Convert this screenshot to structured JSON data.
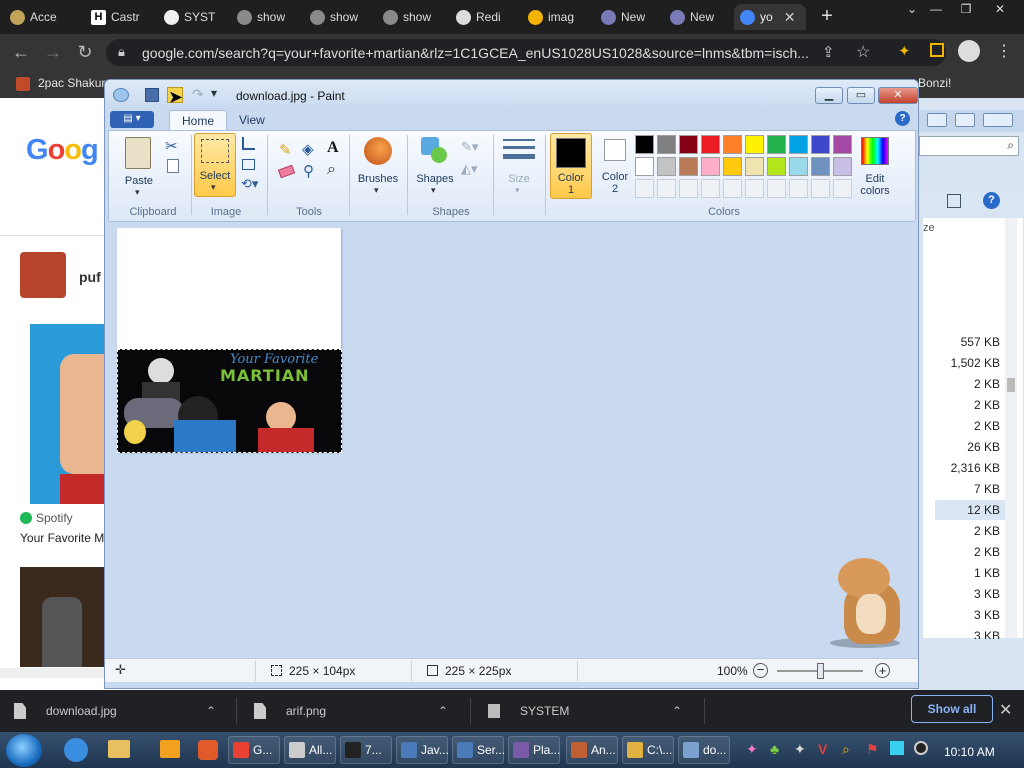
{
  "browser": {
    "tabs": [
      {
        "label": "Acce",
        "color": "#c3a35a"
      },
      {
        "label": "Castr",
        "color": "#ffffff"
      },
      {
        "label": "SYST",
        "color": "#f0f0f0"
      },
      {
        "label": "show",
        "color": "#8a8a8a"
      },
      {
        "label": "show",
        "color": "#8a8a8a"
      },
      {
        "label": "show",
        "color": "#8a8a8a"
      },
      {
        "label": "Redi",
        "color": "#dddddd"
      },
      {
        "label": "imag",
        "color": "#f2b400"
      },
      {
        "label": "New",
        "color": "#7a7ab8"
      },
      {
        "label": "New",
        "color": "#7a7ab8"
      },
      {
        "label": "yo",
        "color": "#4285f4"
      }
    ],
    "active_tab": 10,
    "url": "google.com/search?q=your+favorite+martian&rlz=1C1GCEA_enUS1028US1028&source=lnms&tbm=isch...",
    "bookmarks": [
      "2pac Shakur",
      "Bonzi!"
    ]
  },
  "google_page": {
    "logo": "Goog",
    "result_user": "puf",
    "spotify_label": "Spotify",
    "spotify_title": "Your Favorite M"
  },
  "explorer": {
    "partial_label": "ze",
    "sizes": [
      "557 KB",
      "1,502 KB",
      "2 KB",
      "2 KB",
      "2 KB",
      "26 KB",
      "2,316 KB",
      "7 KB",
      "12 KB",
      "2 KB",
      "2 KB",
      "1 KB",
      "3 KB",
      "3 KB",
      "3 KB"
    ]
  },
  "paint": {
    "title": "download.jpg - Paint",
    "tabs": {
      "home": "Home",
      "view": "View"
    },
    "clipboard": {
      "paste": "Paste",
      "group": "Clipboard"
    },
    "image": {
      "select": "Select",
      "group": "Image"
    },
    "tools_group": "Tools",
    "brushes": "Brushes",
    "shapes": {
      "label": "Shapes",
      "group": "Shapes"
    },
    "size": "Size",
    "color1": {
      "label": "Color",
      "num": "1"
    },
    "color2": {
      "label": "Color",
      "num": "2"
    },
    "colors_group": "Colors",
    "edit_colors": {
      "line1": "Edit",
      "line2": "colors"
    },
    "palette": {
      "row1": [
        "#000000",
        "#7f7f7f",
        "#880015",
        "#ed1c24",
        "#ff7f27",
        "#fff200",
        "#22b14c",
        "#00a2e8",
        "#3f48cc",
        "#a349a4"
      ],
      "row2": [
        "#ffffff",
        "#c3c3c3",
        "#b97a57",
        "#ffaec9",
        "#ffc90e",
        "#efe4b0",
        "#b5e61d",
        "#99d9ea",
        "#7092be",
        "#c8bfe7"
      ]
    },
    "image_text": {
      "line1": "Your Favorite",
      "line2": "MARTIAN"
    },
    "status": {
      "selection_size": "225 × 104px",
      "image_size": "225 × 225px",
      "zoom": "100%"
    }
  },
  "open_files": [
    {
      "name": "download.jpg"
    },
    {
      "name": "arif.png"
    },
    {
      "name": "SYSTEM"
    }
  ],
  "show_all": "Show all",
  "taskbar": {
    "items": [
      {
        "label": "G...",
        "color": "#e94235"
      },
      {
        "label": "All...",
        "color": "#cccccc"
      },
      {
        "label": "7...",
        "color": "#222222"
      },
      {
        "label": "Jav...",
        "color": "#4a7ab8"
      },
      {
        "label": "Ser...",
        "color": "#4a7ab8"
      },
      {
        "label": "Pla...",
        "color": "#7a5aa8"
      },
      {
        "label": "An...",
        "color": "#c06030"
      },
      {
        "label": "C:\\...",
        "color": "#e0b040"
      },
      {
        "label": "do...",
        "color": "#7aa0d0"
      }
    ],
    "clock": "10:10 AM"
  }
}
